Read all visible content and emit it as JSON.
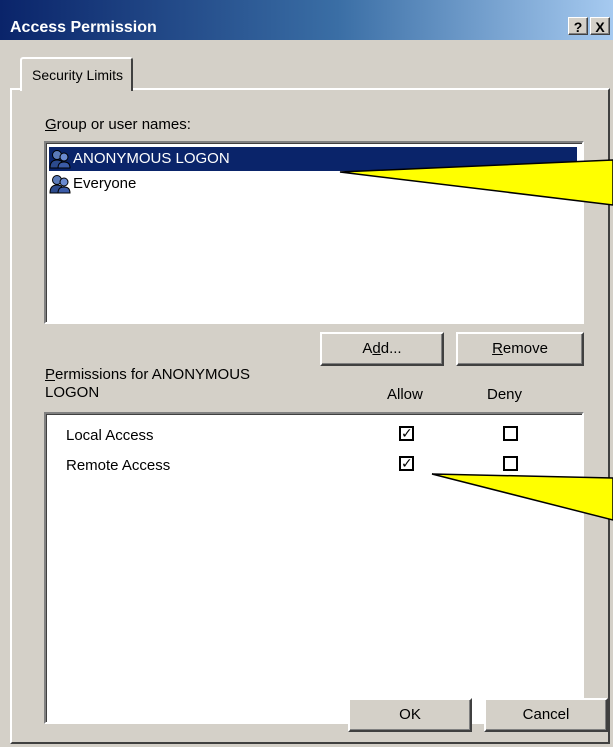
{
  "window": {
    "title": "Access Permission",
    "help_label": "?",
    "close_label": "X"
  },
  "tab": {
    "label": "Security Limits"
  },
  "users": {
    "label_accel": "G",
    "label_rest": "roup or user names:",
    "items": [
      {
        "name": "ANONYMOUS LOGON",
        "selected": true
      },
      {
        "name": "Everyone",
        "selected": false
      }
    ]
  },
  "buttons": {
    "add_pre": "A",
    "add_accel": "d",
    "add_post": "d...",
    "remove_accel": "R",
    "remove_rest": "emove",
    "ok": "OK",
    "cancel": "Cancel"
  },
  "permissions": {
    "label_accel": "P",
    "label_line1_rest": "ermissions for ANONYMOUS",
    "label_line2": "LOGON",
    "allow_header": "Allow",
    "deny_header": "Deny",
    "rows": [
      {
        "name": "Local Access",
        "allow": true,
        "deny": false
      },
      {
        "name": "Remote Access",
        "allow": true,
        "deny": false
      }
    ]
  },
  "icons": {
    "user_group": "user-group-icon",
    "check": "✓"
  },
  "colors": {
    "titlebar_start": "#0A246A",
    "selection": "#0A246A",
    "callout_fill": "#FFFF00",
    "face": "#D4D0C8"
  }
}
